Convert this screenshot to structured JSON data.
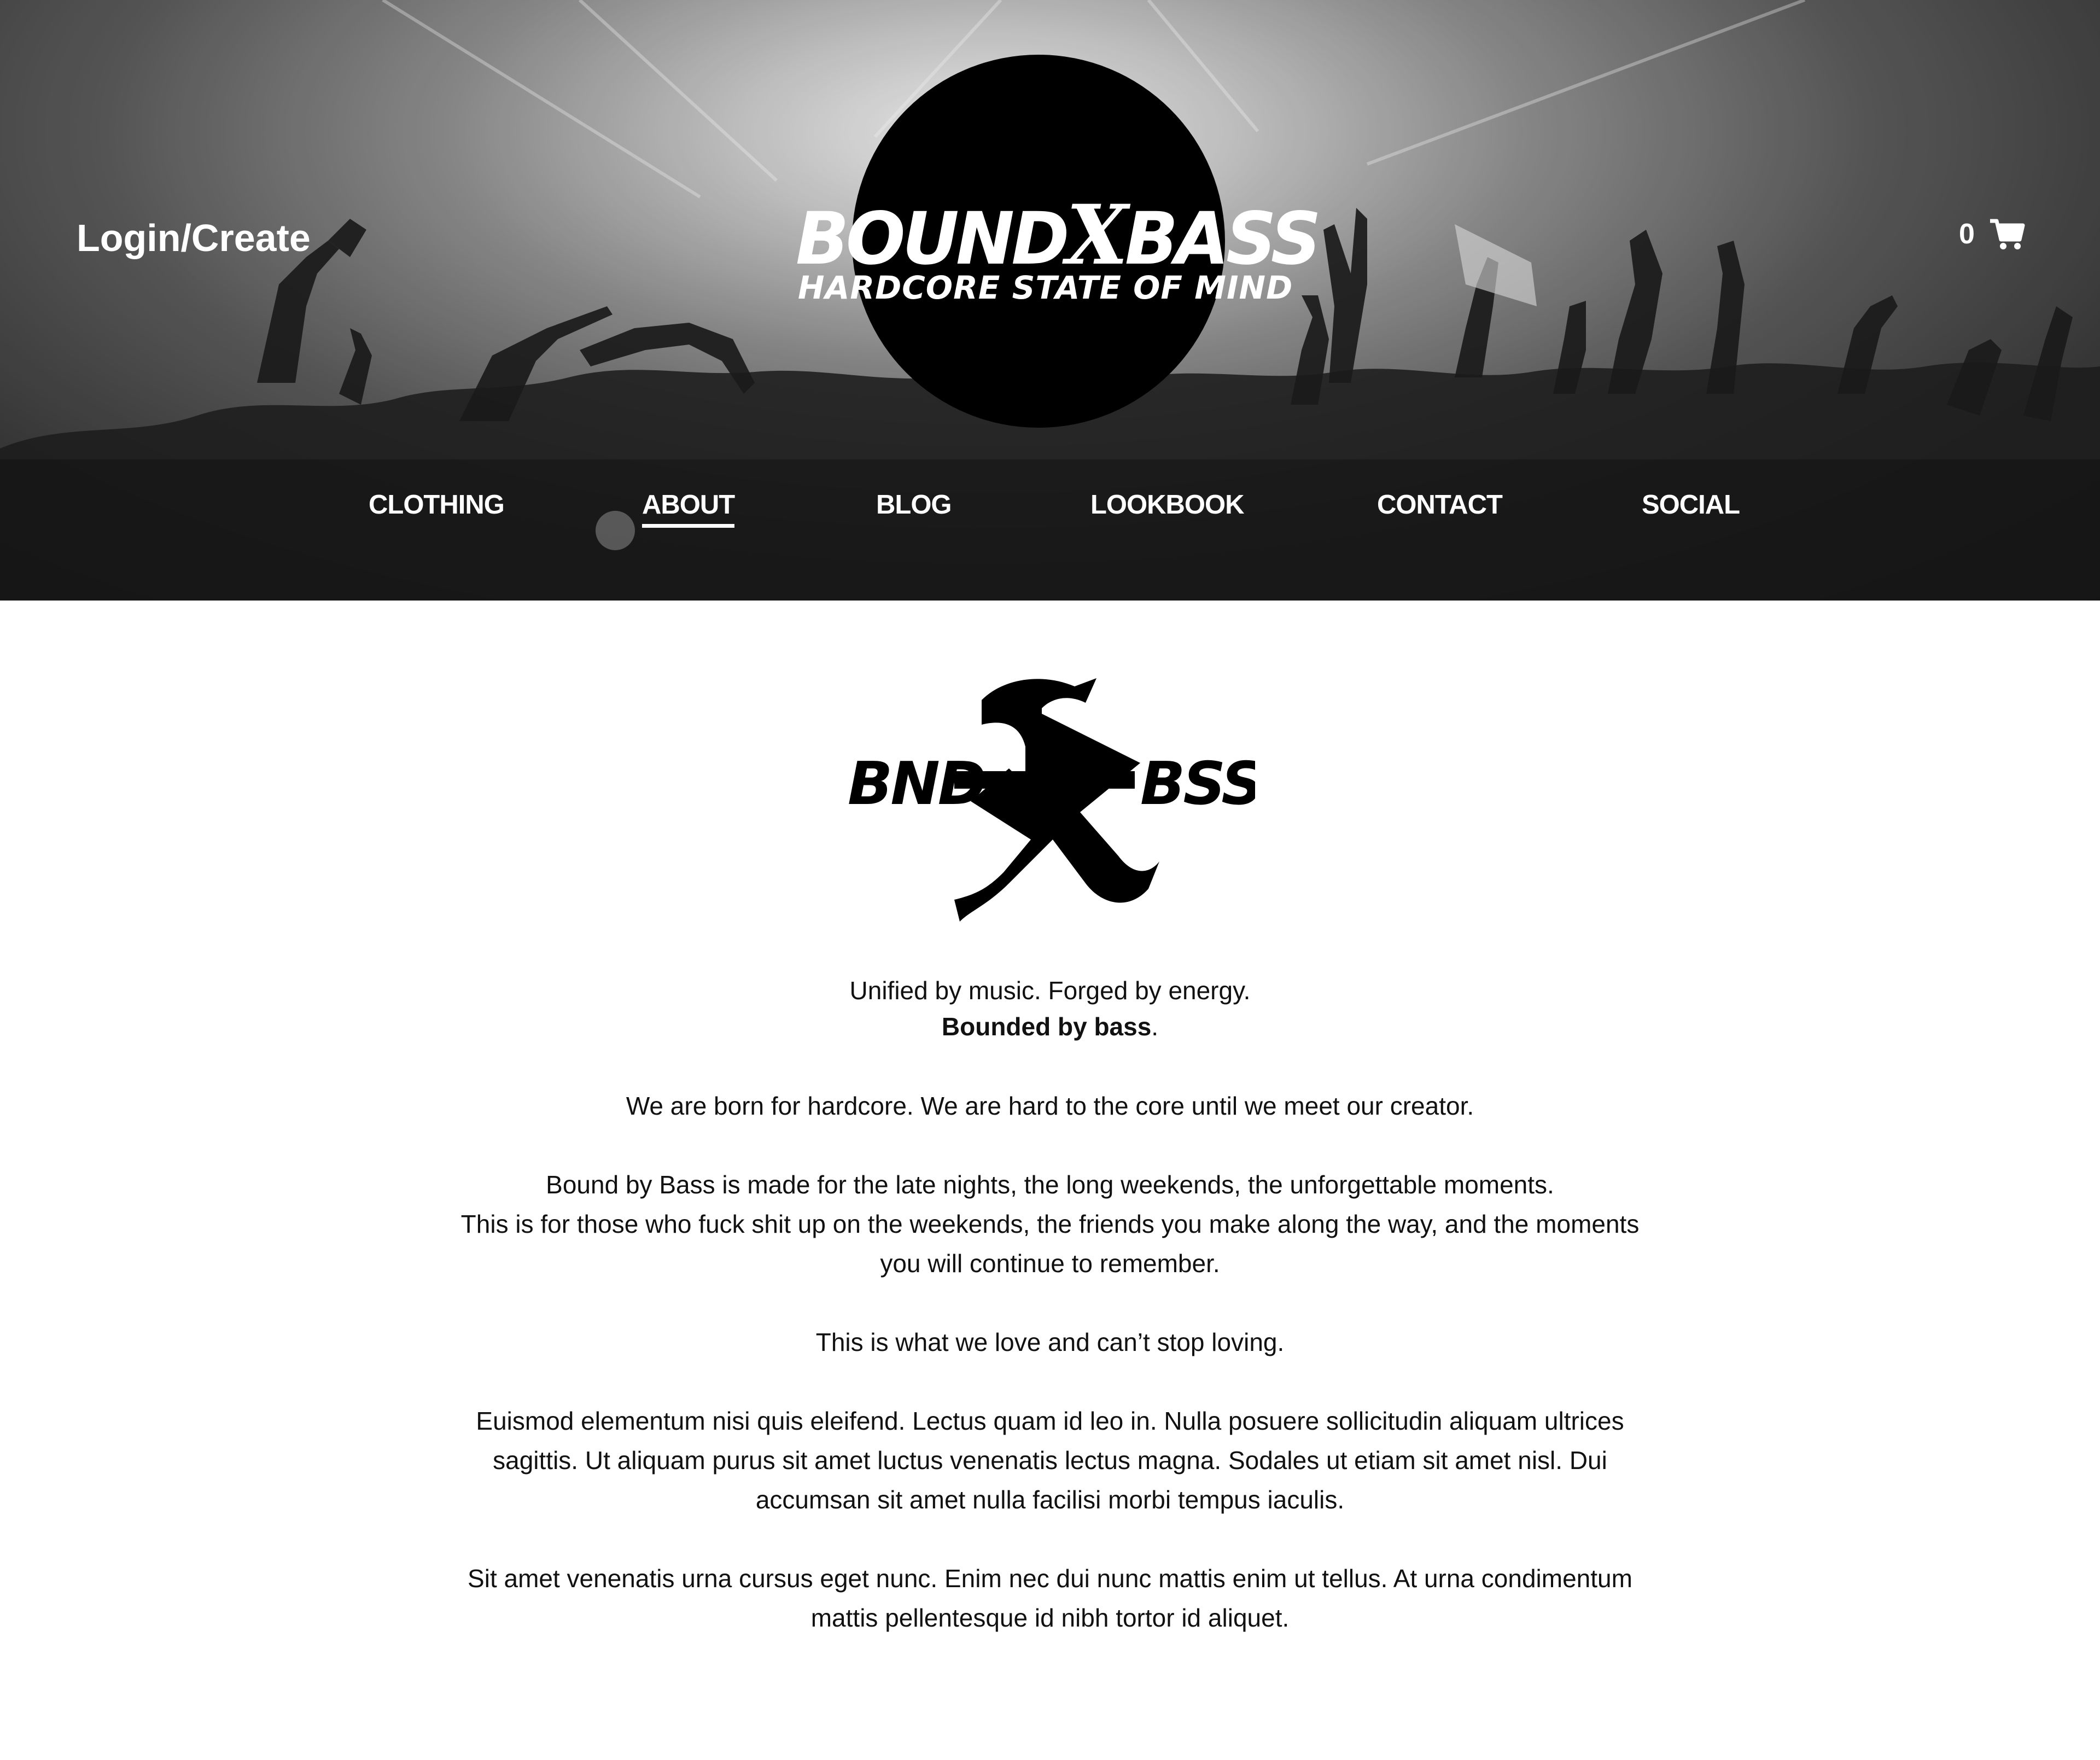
{
  "header": {
    "login_label": "Login/Create",
    "logo": {
      "brand_part1": "BOUND",
      "brand_x": "X",
      "brand_part2": "BASS",
      "tagline": "HARDCORE STATE OF MIND"
    },
    "cart": {
      "count": "0",
      "icon": "cart-icon"
    }
  },
  "nav": {
    "items": [
      {
        "label": "CLOTHING",
        "active": false
      },
      {
        "label": "ABOUT",
        "active": true
      },
      {
        "label": "BLOG",
        "active": false
      },
      {
        "label": "LOOKBOOK",
        "active": false
      },
      {
        "label": "CONTACT",
        "active": false
      },
      {
        "label": "SOCIAL",
        "active": false
      }
    ]
  },
  "about": {
    "emblem": {
      "left": "BND",
      "middle": "X",
      "right": "BSS"
    },
    "tagline_line1": "Unified by music. Forged by energy.",
    "tagline_bold": "Bounded by bass",
    "tagline_period": ".",
    "paragraph1": "We are born for hardcore. We are hard to the core until we meet our creator.",
    "paragraph2_line1": "Bound by Bass is made for the late nights, the long weekends, the unforgettable moments.",
    "paragraph2_line2": "This is for those who fuck shit up on the weekends, the friends you make along the way, and the moments you will continue to remember.",
    "paragraph3": "This is what we love and can’t stop loving.",
    "paragraph4": "Euismod elementum nisi quis eleifend. Lectus quam id leo in. Nulla posuere sollicitudin aliquam ultrices sagittis. Ut aliquam purus sit amet luctus venenatis lectus magna. Sodales ut etiam sit amet nisl. Dui accumsan sit amet nulla facilisi morbi tempus iaculis.",
    "paragraph5": "Sit amet venenatis urna cursus eget nunc. Enim nec dui nunc mattis enim ut tellus. At urna condimentum mattis pellentesque id nibh tortor id aliquet."
  },
  "colors": {
    "text": "#111111",
    "header_text": "#ffffff",
    "logo_circle": "#000000",
    "background": "#ffffff"
  }
}
